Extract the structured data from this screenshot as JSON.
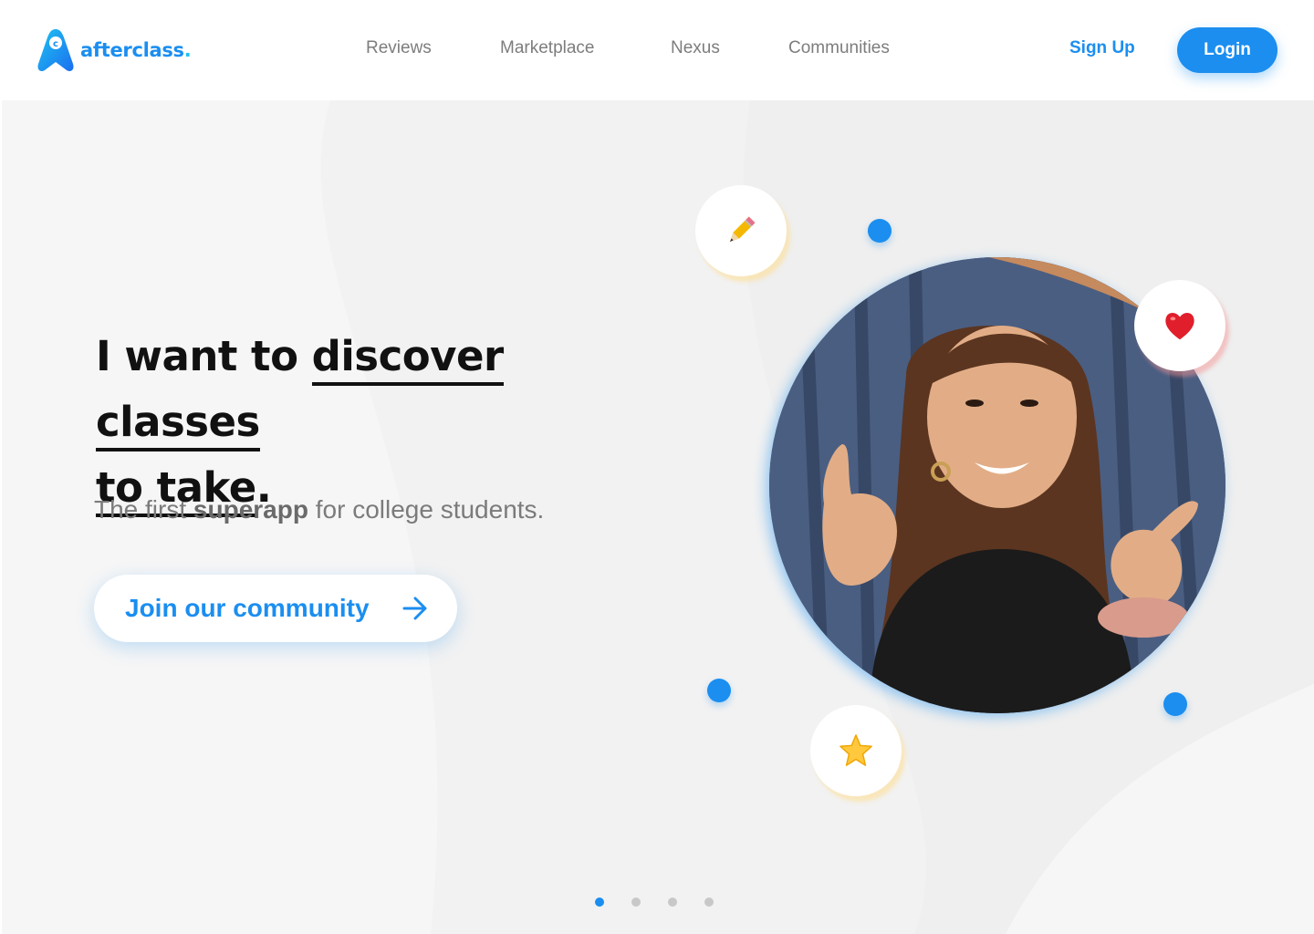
{
  "brand": {
    "name": "afterclass",
    "dot": ".",
    "colors": {
      "primary": "#1b8ef0",
      "accent": "#1ec3f0",
      "text": "#111111"
    }
  },
  "nav": {
    "items": [
      {
        "label": "Reviews"
      },
      {
        "label": "Marketplace"
      },
      {
        "label": "Nexus"
      },
      {
        "label": "Communities"
      }
    ],
    "signup_label": "Sign Up",
    "login_label": "Login"
  },
  "hero": {
    "headline_prefix": "I want to ",
    "headline_highlight_1": "discover classes",
    "headline_highlight_2": "to take",
    "headline_suffix": ".",
    "subtitle_pre": "The first ",
    "subtitle_bold": "superapp",
    "subtitle_post": " for college students.",
    "cta_label": "Join our community",
    "cta_icon": "arrow-right-icon",
    "bubbles": [
      {
        "icon": "pencil-icon"
      },
      {
        "icon": "heart-icon"
      },
      {
        "icon": "star-icon"
      }
    ]
  },
  "carousel": {
    "slide_count": 4,
    "active_index": 0
  }
}
